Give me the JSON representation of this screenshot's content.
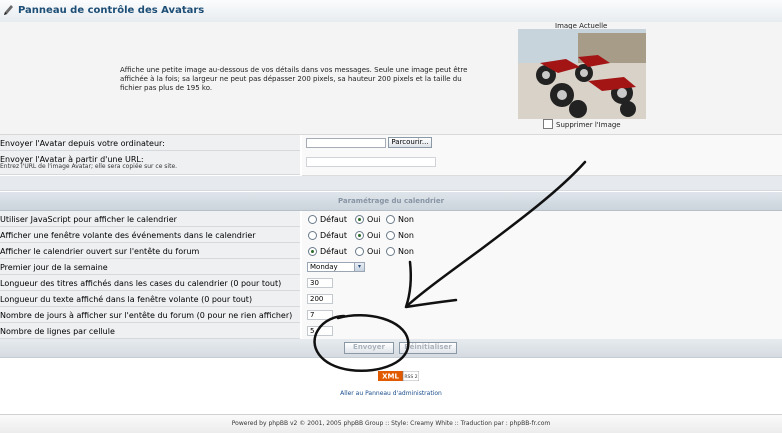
{
  "header": {
    "title": "Panneau de contrôle des Avatars"
  },
  "avatar": {
    "description": "Affiche une petite image au-dessous de vos détails dans vos messages. Seule une image peut être affichée à la fois; sa largeur ne peut pas dépasser 200 pixels, sa hauteur 200 pixels et la taille du fichier pas plus de 195 ko.",
    "current_image_label": "Image Actuelle",
    "delete_label": "Supprimer l'Image"
  },
  "upload": {
    "label": "Envoyer l'Avatar depuis votre ordinateur:",
    "browse_button": "Parcourir..."
  },
  "url": {
    "label": "Envoyer l'Avatar à partir d'une URL:",
    "sublabel": "Entrez l'URL de l'image Avatar; elle sera copiée sur ce site.",
    "value": ""
  },
  "calendar": {
    "section_title": "Paramétrage du calendrier",
    "rows": [
      {
        "label": "Utiliser JavaScript pour afficher le calendrier",
        "options": [
          "Défaut",
          "Oui",
          "Non"
        ],
        "selected": "Oui"
      },
      {
        "label": "Afficher une fenêtre volante des événements dans le calendrier",
        "options": [
          "Défaut",
          "Oui",
          "Non"
        ],
        "selected": "Oui"
      },
      {
        "label": "Afficher le calendrier ouvert sur l'entête du forum",
        "options": [
          "Défaut",
          "Oui",
          "Non"
        ],
        "selected": "Défaut"
      },
      {
        "label": "Premier jour de la semaine",
        "select_value": "Monday"
      },
      {
        "label": "Longueur des titres affichés dans les cases du calendrier (0 pour tout)",
        "value": "30"
      },
      {
        "label": "Longueur du texte affiché dans la fenêtre volante (0 pour tout)",
        "value": "200"
      },
      {
        "label": "Nombre de jours à afficher sur l'entête du forum (0 pour ne rien afficher)",
        "value": "7"
      },
      {
        "label": "Nombre de lignes par cellule",
        "value": "5"
      }
    ]
  },
  "buttons": {
    "submit": "Envoyer",
    "reset": "Réinitialiser"
  },
  "rss": {
    "xml": "XML",
    "rss": "RSS 2"
  },
  "admin_link": "Aller au Panneau d'administration",
  "footer": "Powered by phpBB v2 © 2001, 2005 phpBB Group :: Style: Creamy White :: Traduction par : phpBB-fr.com",
  "colors": {
    "title": "#1d4e76",
    "link": "#1a4d8c",
    "radio_checked": "#2b6d28",
    "annotation": "#111111"
  }
}
